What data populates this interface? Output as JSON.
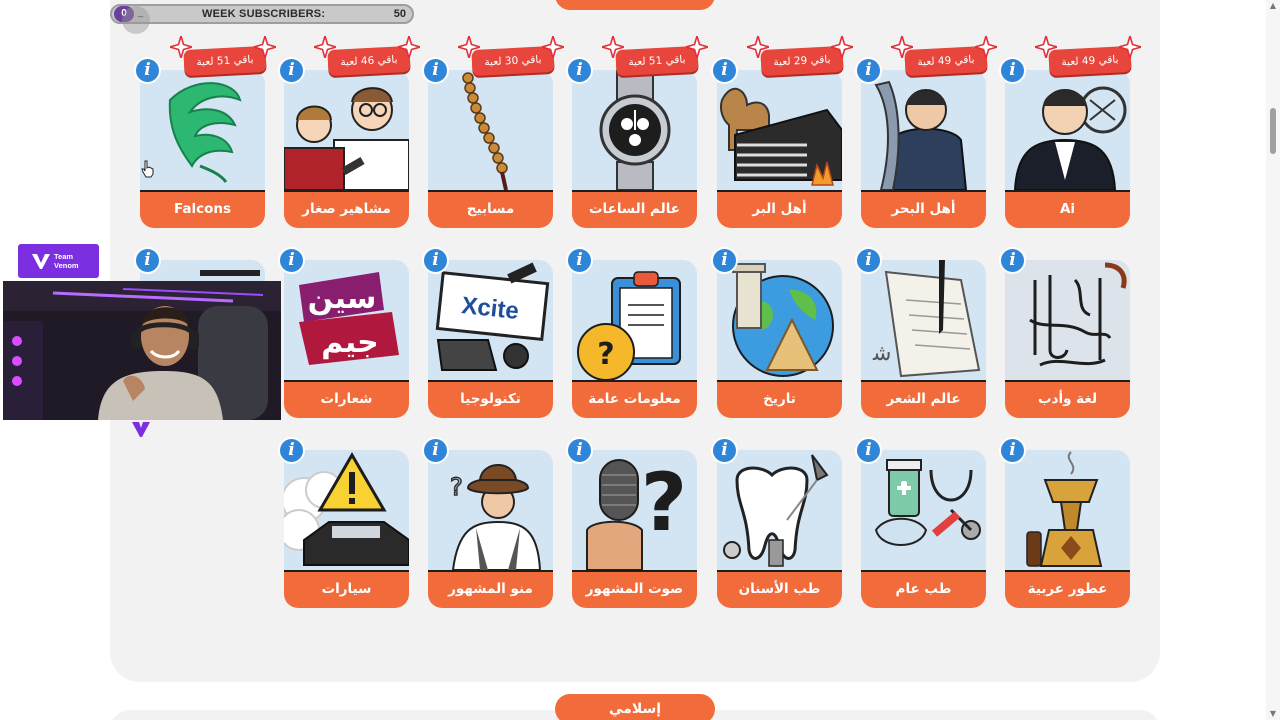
{
  "overlay": {
    "subscriber_count": "0",
    "subscriber_label": "WEEK SUBSCRIBERS:",
    "subscriber_goal": "50",
    "subscriber_dash": "_",
    "team_name": "Team Venom"
  },
  "sections": {
    "top_pill": "",
    "bottom_pill": "إسلامي"
  },
  "badge_info_glyph": "i",
  "rows": [
    {
      "cards": [
        {
          "label": "Falcons",
          "badge": "باقي 51 لعبة",
          "icon": "falcon-logo-icon"
        },
        {
          "label": "مشاهير صغار",
          "badge": "باقي 46 لعبة",
          "icon": "kids-celebrities-icon"
        },
        {
          "label": "مسابيح",
          "badge": "باقي 30 لعبة",
          "icon": "prayer-beads-icon"
        },
        {
          "label": "عالم الساعات",
          "badge": "باقي 51 لعبة",
          "icon": "wristwatch-icon"
        },
        {
          "label": "أهل البر",
          "badge": "باقي 29 لعبة",
          "icon": "camel-tent-icon"
        },
        {
          "label": "أهل البحر",
          "badge": "باقي 49 لعبة",
          "icon": "fisherman-icon"
        },
        {
          "label": "Ai",
          "badge": "باقي 49 لعبة",
          "icon": "ai-person-icon"
        }
      ]
    },
    {
      "cards": [
        {
          "label": "",
          "badge": "",
          "icon": "hidden-card-icon"
        },
        {
          "label": "شعارات",
          "badge": "",
          "icon": "logos-icon"
        },
        {
          "label": "تكنولوجيا",
          "badge": "",
          "icon": "xcite-tech-icon"
        },
        {
          "label": "معلومات عامة",
          "badge": "",
          "icon": "clipboard-question-icon"
        },
        {
          "label": "تاريخ",
          "badge": "",
          "icon": "globe-history-icon"
        },
        {
          "label": "عالم الشعر",
          "badge": "",
          "icon": "poetry-paper-icon"
        },
        {
          "label": "لغة وأدب",
          "badge": "",
          "icon": "arabic-calligraphy-icon"
        }
      ]
    },
    {
      "cards": [
        {
          "label": "سيارات",
          "badge": "",
          "icon": "car-warning-icon"
        },
        {
          "label": "منو المشهور",
          "badge": "",
          "icon": "mystery-man-icon"
        },
        {
          "label": "صوت المشهور",
          "badge": "",
          "icon": "microphone-question-icon"
        },
        {
          "label": "طب الأسنان",
          "badge": "",
          "icon": "tooth-icon"
        },
        {
          "label": "طب عام",
          "badge": "",
          "icon": "medical-kit-icon"
        },
        {
          "label": "عطور عربية",
          "badge": "",
          "icon": "incense-burner-icon"
        }
      ]
    }
  ],
  "colors": {
    "card_label_bg": "#f26b3a",
    "info_button": "#2f86d8",
    "badge_bg": "#e8453c",
    "card_image_bg": "#d3e4f3",
    "panel_bg": "#f2f2f2",
    "team_badge": "#7b2fe0"
  }
}
